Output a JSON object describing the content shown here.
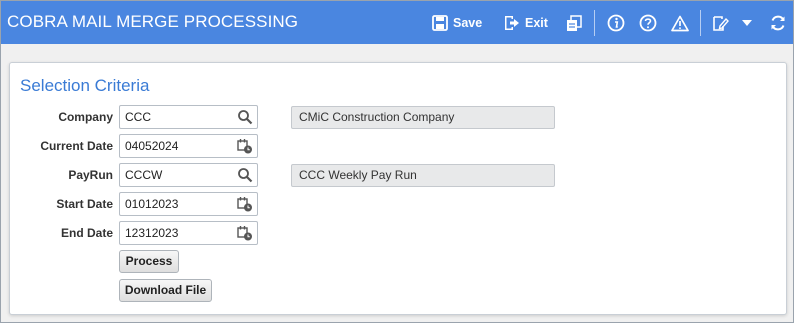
{
  "header": {
    "title": "COBRA MAIL MERGE PROCESSING",
    "save_label": "Save",
    "exit_label": "Exit",
    "icons": [
      "save-icon",
      "exit-icon",
      "reports-icon",
      "info-icon",
      "help-icon",
      "warning-icon",
      "notes-icon",
      "dropdown-caret-icon",
      "refresh-icon"
    ],
    "bar_color": "#4a86e0"
  },
  "selection": {
    "title": "Selection Criteria",
    "accent_color": "#3a7bd5",
    "company": {
      "label": "Company",
      "value": "CCC",
      "description": "CMiC Construction Company"
    },
    "current_date": {
      "label": "Current Date",
      "value": "04052024"
    },
    "payrun": {
      "label": "PayRun",
      "value": "CCCW",
      "description": "CCC Weekly Pay Run"
    },
    "start_date": {
      "label": "Start Date",
      "value": "01012023"
    },
    "end_date": {
      "label": "End Date",
      "value": "12312023"
    },
    "process_label": "Process",
    "download_label": "Download File"
  }
}
